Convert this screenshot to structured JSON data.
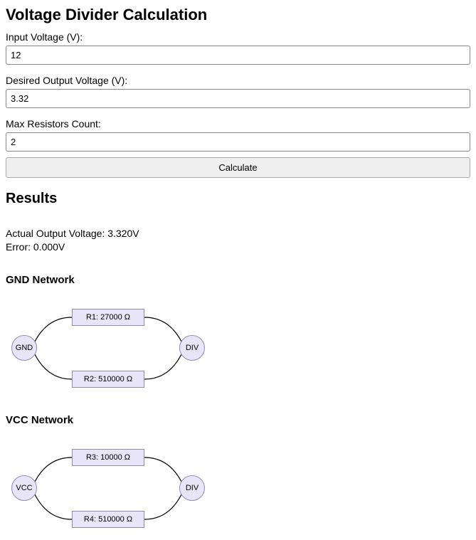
{
  "title": "Voltage Divider Calculation",
  "fields": {
    "input_voltage": {
      "label": "Input Voltage (V):",
      "value": "12"
    },
    "output_voltage": {
      "label": "Desired Output Voltage (V):",
      "value": "3.32"
    },
    "max_resistors": {
      "label": "Max Resistors Count:",
      "value": "2"
    }
  },
  "calculate_button": "Calculate",
  "results": {
    "title": "Results",
    "actual_voltage_label": "Actual Output Voltage: ",
    "actual_voltage_value": "3.320V",
    "error_label": "Error: ",
    "error_value": "0.000V"
  },
  "networks": {
    "gnd": {
      "title": "GND Network",
      "left_node": "GND",
      "right_node": "DIV",
      "resistors": [
        "R1: 27000 Ω",
        "R2: 510000 Ω"
      ]
    },
    "vcc": {
      "title": "VCC Network",
      "left_node": "VCC",
      "right_node": "DIV",
      "resistors": [
        "R3: 10000 Ω",
        "R4: 510000 Ω"
      ]
    }
  }
}
